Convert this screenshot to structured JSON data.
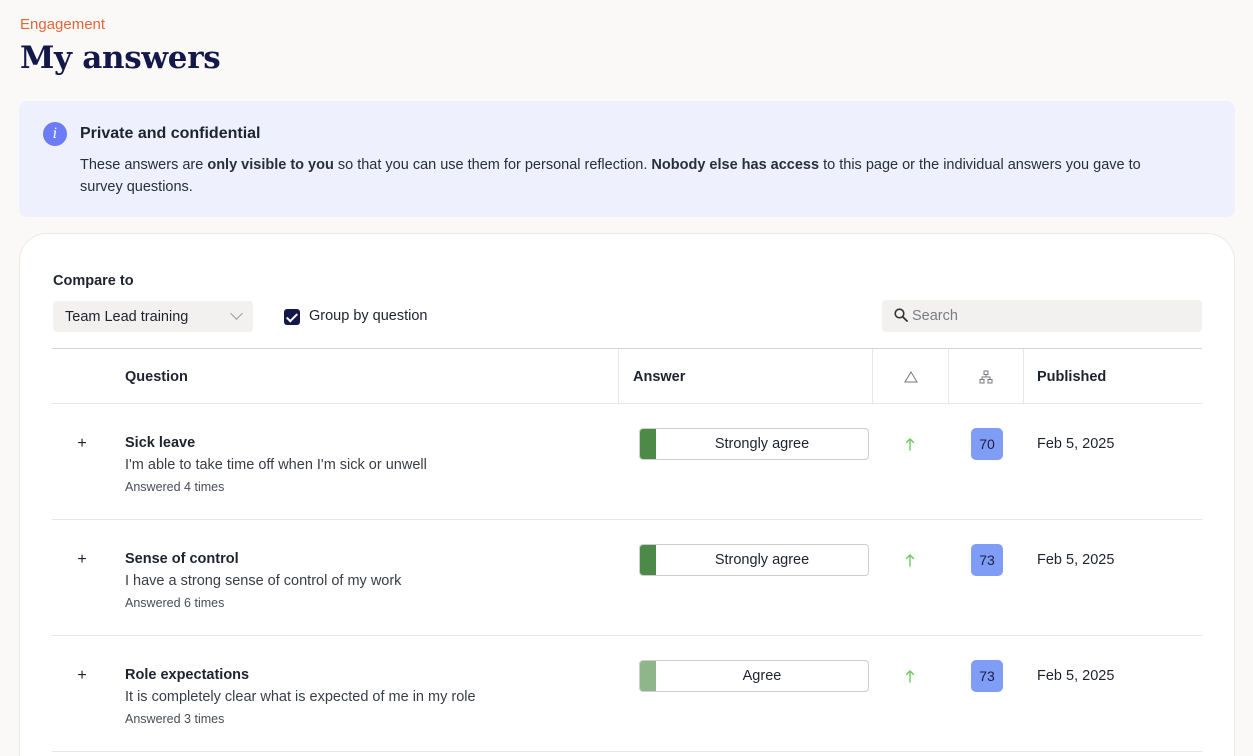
{
  "header": {
    "breadcrumb": "Engagement",
    "title": "My answers"
  },
  "notice": {
    "title": "Private and confidential",
    "text_1": "These answers are ",
    "bold_1": "only visible to you",
    "text_2": " so that you can use them for personal reflection. ",
    "bold_2": "Nobody else has access",
    "text_3": " to this page or the individual answers you gave to survey questions."
  },
  "filters": {
    "compare_label": "Compare to",
    "compare_value": "Team Lead training",
    "group_label": "Group by question",
    "group_checked": true,
    "search_placeholder": "Search"
  },
  "table": {
    "headers": {
      "question": "Question",
      "answer": "Answer",
      "published": "Published"
    },
    "rows": [
      {
        "title": "Sick leave",
        "question": "I'm able to take time off when I'm sick or unwell",
        "count": "Answered 4 times",
        "answer": "Strongly agree",
        "answer_color": "#4e8a47",
        "score": "70",
        "published": "Feb 5, 2025"
      },
      {
        "title": "Sense of control",
        "question": "I have a strong sense of control of my work",
        "count": "Answered 6 times",
        "answer": "Strongly agree",
        "answer_color": "#4e8a47",
        "score": "73",
        "published": "Feb 5, 2025"
      },
      {
        "title": "Role expectations",
        "question": "It is completely clear what is expected of me in my role",
        "count": "Answered 3 times",
        "answer": "Agree",
        "answer_color": "#8fb58a",
        "score": "73",
        "published": "Feb 5, 2025"
      }
    ]
  },
  "colors": {
    "accent_orange": "#e0663a",
    "title_navy": "#14174a",
    "trend_up_green": "#6ccb5f",
    "score_blue": "#7f9df5"
  }
}
